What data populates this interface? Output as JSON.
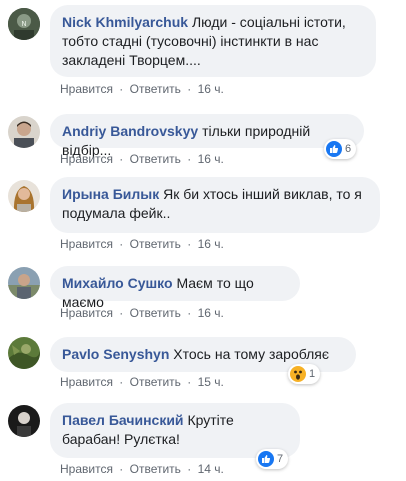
{
  "comments": [
    {
      "author": "Nick Khmilyarchuk",
      "text": "Люди - соціальні істоти, тобто стадні (тусовочні) інстинкти в нас закладені Творцем....",
      "like_label": "Нравится",
      "reply_label": "Ответить",
      "separator": "·",
      "time": "16 ч."
    },
    {
      "author": "Andriy Bandrovskyy",
      "text": "тільки природній відбір...",
      "like_label": "Нравится",
      "reply_label": "Ответить",
      "separator": "·",
      "time": "16 ч.",
      "reaction": {
        "icon": "like-icon",
        "count": "6"
      }
    },
    {
      "author": "Ирына Билык",
      "text": "Як би хтось інший виклав, то я подумала фейк..",
      "like_label": "Нравится",
      "reply_label": "Ответить",
      "separator": "·",
      "time": "16 ч."
    },
    {
      "author": "Михайло Сушко",
      "text": "Маєм то що маємо",
      "like_label": "Нравится",
      "reply_label": "Ответить",
      "separator": "·",
      "time": "16 ч."
    },
    {
      "author": "Pavlo Senyshyn",
      "text": "Хтось на тому заробляє",
      "like_label": "Нравится",
      "reply_label": "Ответить",
      "separator": "·",
      "time": "15 ч.",
      "reaction": {
        "icon": "wow-icon",
        "count": "1"
      }
    },
    {
      "author": "Павел Бачинский",
      "text": "Крутіте барабан! Рулєтка!",
      "like_label": "Нравится",
      "reply_label": "Ответить",
      "separator": "·",
      "time": "14 ч.",
      "reaction": {
        "icon": "like-icon",
        "count": "7"
      }
    }
  ],
  "colors": {
    "author_link": "#385898",
    "bubble_bg": "#f0f2f5",
    "meta_text": "#606770",
    "like_blue": "#1877f2",
    "wow_yellow": "#f7b125"
  }
}
